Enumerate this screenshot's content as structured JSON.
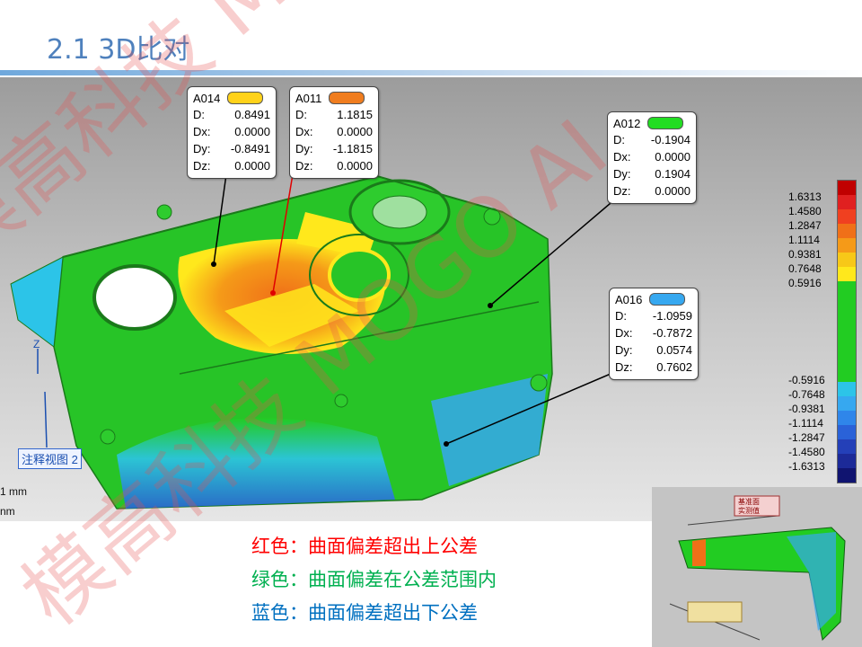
{
  "slide": {
    "title": "2.1   3D比对"
  },
  "callouts": [
    {
      "id": "A014",
      "swatch": "#ffd21a",
      "rows": [
        {
          "k": "D:",
          "v": "0.8491"
        },
        {
          "k": "Dx:",
          "v": "0.0000"
        },
        {
          "k": "Dy:",
          "v": "-0.8491"
        },
        {
          "k": "Dz:",
          "v": "0.0000"
        }
      ]
    },
    {
      "id": "A011",
      "swatch": "#f07d1f",
      "rows": [
        {
          "k": "D:",
          "v": "1.1815"
        },
        {
          "k": "Dx:",
          "v": "0.0000"
        },
        {
          "k": "Dy:",
          "v": "-1.1815"
        },
        {
          "k": "Dz:",
          "v": "0.0000"
        }
      ]
    },
    {
      "id": "A012",
      "swatch": "#22dd22",
      "rows": [
        {
          "k": "D:",
          "v": "-0.1904"
        },
        {
          "k": "Dx:",
          "v": "0.0000"
        },
        {
          "k": "Dy:",
          "v": "0.1904"
        },
        {
          "k": "Dz:",
          "v": "0.0000"
        }
      ]
    },
    {
      "id": "A016",
      "swatch": "#36a8f0",
      "rows": [
        {
          "k": "D:",
          "v": "-1.0959"
        },
        {
          "k": "Dx:",
          "v": "-0.7872"
        },
        {
          "k": "Dy:",
          "v": "0.0574"
        },
        {
          "k": "Dz:",
          "v": "0.7602"
        }
      ]
    }
  ],
  "legend": {
    "labels": [
      "1.6313",
      "1.4580",
      "1.2847",
      "1.1114",
      "0.9381",
      "0.7648",
      "0.5916",
      "-0.5916",
      "-0.7648",
      "-0.9381",
      "-1.1114",
      "-1.2847",
      "-1.4580",
      "-1.6313"
    ],
    "colors": {
      "top": [
        "#c00000",
        "#e02020",
        "#f04020",
        "#f07018",
        "#f59a18",
        "#f7c818",
        "#ffe81c"
      ],
      "mid": "#22cc22",
      "bottom": [
        "#2cc4e8",
        "#36a8f0",
        "#2f86ea",
        "#2a62d8",
        "#2440b8",
        "#1c2a98",
        "#101470"
      ]
    }
  },
  "viewport": {
    "axis_z": "Z",
    "axis_y": "Y",
    "view_tag": "注释视图 2",
    "scale_1": "1 mm",
    "scale_2": "nm"
  },
  "notes": [
    {
      "text": "红色：曲面偏差超出上公差",
      "color": "#ff0000"
    },
    {
      "text": "绿色：曲面偏差在公差范围内",
      "color": "#00b050"
    },
    {
      "text": "蓝色：曲面偏差超出下公差",
      "color": "#0070c0"
    }
  ],
  "thumbnail": {
    "tag_1": "基准面",
    "tag_2": "实测值"
  },
  "watermark": {
    "text_1": "模高科技 MOGO",
    "text_2": "模高科技 MOGO AI"
  }
}
